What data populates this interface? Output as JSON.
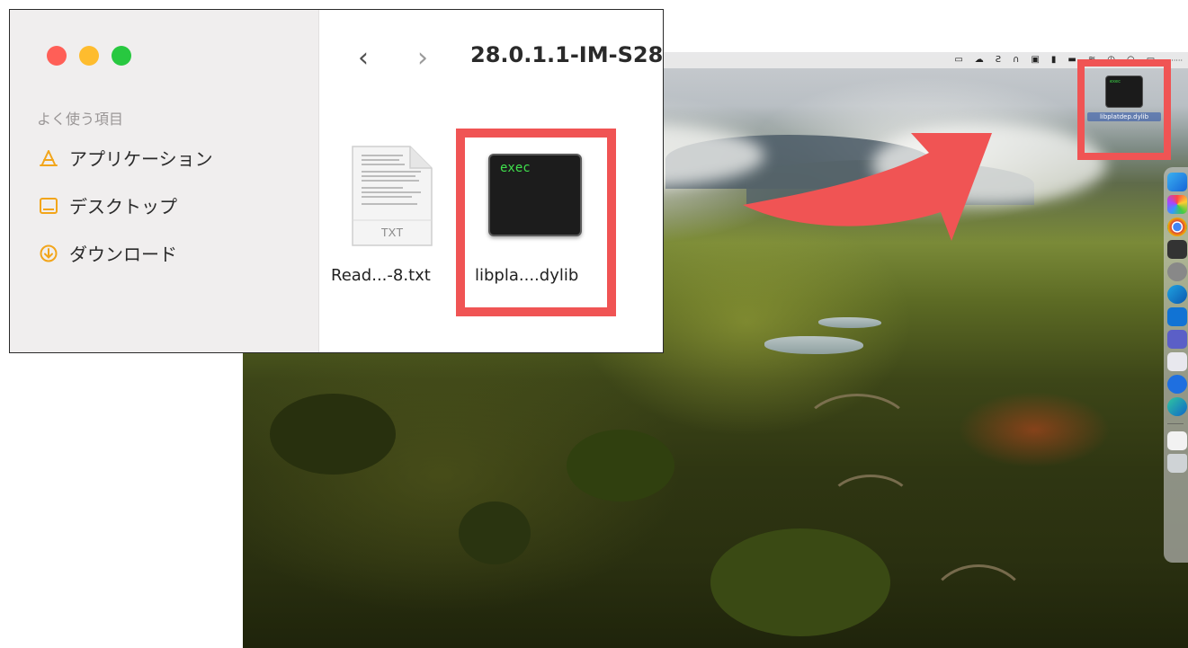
{
  "finder": {
    "folder_title": "28.0.1.1-IM-S28",
    "sidebar": {
      "heading": "よく使う項目",
      "items": [
        {
          "label": "アプリケーション",
          "icon": "applications-icon"
        },
        {
          "label": "デスクトップ",
          "icon": "desktop-icon"
        },
        {
          "label": "ダウンロード",
          "icon": "downloads-icon"
        }
      ]
    },
    "files": [
      {
        "label": "Read...-8.txt",
        "icon": "txt-document-icon",
        "badge": "TXT"
      },
      {
        "label": "libpla....dylib",
        "icon": "exec-file-icon",
        "badge": "exec"
      }
    ]
  },
  "desktop": {
    "file": {
      "label": "libplatdep.dylib",
      "badge": "exec"
    }
  },
  "colors": {
    "highlight": "#f05454",
    "traffic_close": "#ff5f57",
    "traffic_minimize": "#febc2e",
    "traffic_zoom": "#28c840"
  }
}
